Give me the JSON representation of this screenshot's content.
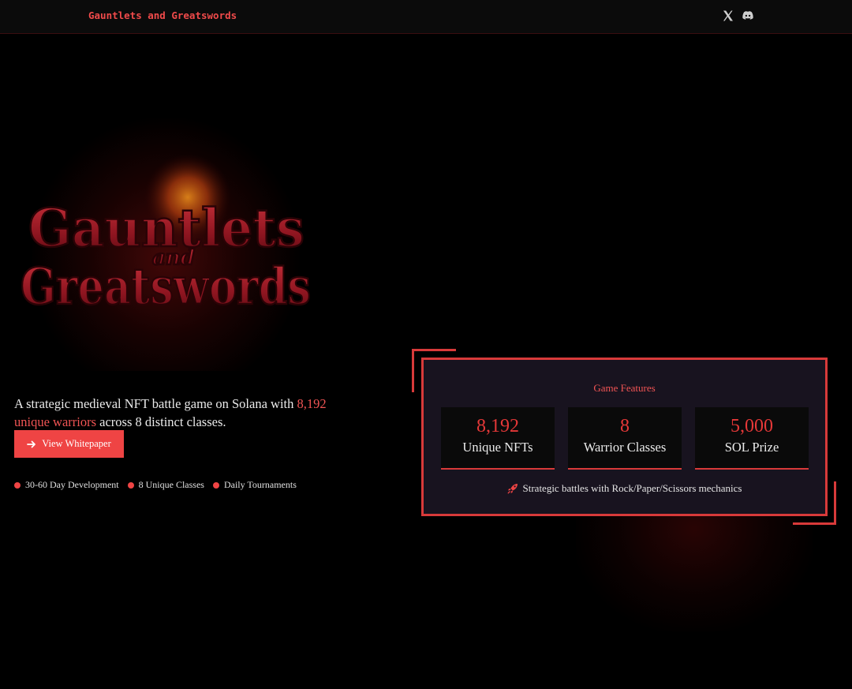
{
  "header": {
    "brand": "Gauntlets and Greatswords",
    "social_icons": [
      "x-icon",
      "discord-icon"
    ]
  },
  "hero": {
    "logo": {
      "line1": "Gauntlets",
      "line2": "and",
      "line3": "Greatswords"
    },
    "tagline": {
      "before": "A strategic medieval NFT battle game on Solana with ",
      "highlight": "8,192 unique warriors",
      "after": " across 8 distinct classes."
    },
    "cta_label": "View Whitepaper",
    "cta_icon": "arrow-right-icon",
    "pills": [
      "30-60 Day Development",
      "8 Unique Classes",
      "Daily Tournaments"
    ]
  },
  "features": {
    "title": "Game Features",
    "stats": [
      {
        "value": "8,192",
        "label": "Unique NFTs"
      },
      {
        "value": "8",
        "label": "Warrior Classes"
      },
      {
        "value": "5,000",
        "label": "SOL Prize"
      }
    ],
    "footer_icon": "rocket-icon",
    "footer_text": "Strategic battles with Rock/Paper/Scissors mechanics"
  },
  "colors": {
    "accent": "#ef4444",
    "panel_bg": "#18131f",
    "background": "#000000"
  }
}
